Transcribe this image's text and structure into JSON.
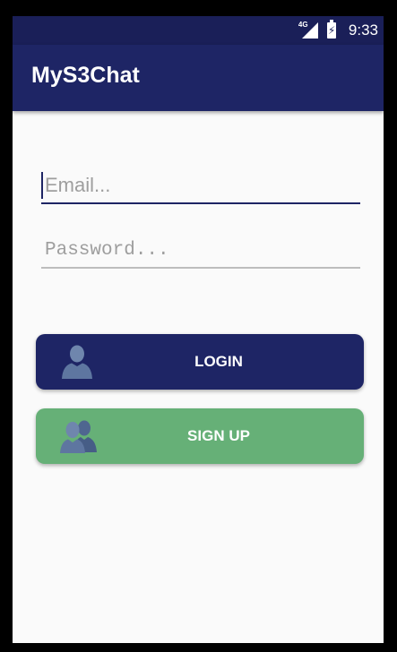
{
  "status_bar": {
    "network_label": "4G",
    "time": "9:33",
    "icons": [
      "signal-icon",
      "battery-charging-icon"
    ]
  },
  "app_bar": {
    "title": "MyS3Chat"
  },
  "form": {
    "email_placeholder": "Email...",
    "email_value": "",
    "password_placeholder": "Password...",
    "password_value": ""
  },
  "buttons": {
    "login_label": "LOGIN",
    "login_icon": "user-icon",
    "signup_label": "SIGN UP",
    "signup_icon": "users-icon"
  },
  "colors": {
    "status_bar": "#1a1f58",
    "primary": "#1e2565",
    "signup": "#66b077",
    "background": "#fafafa"
  }
}
